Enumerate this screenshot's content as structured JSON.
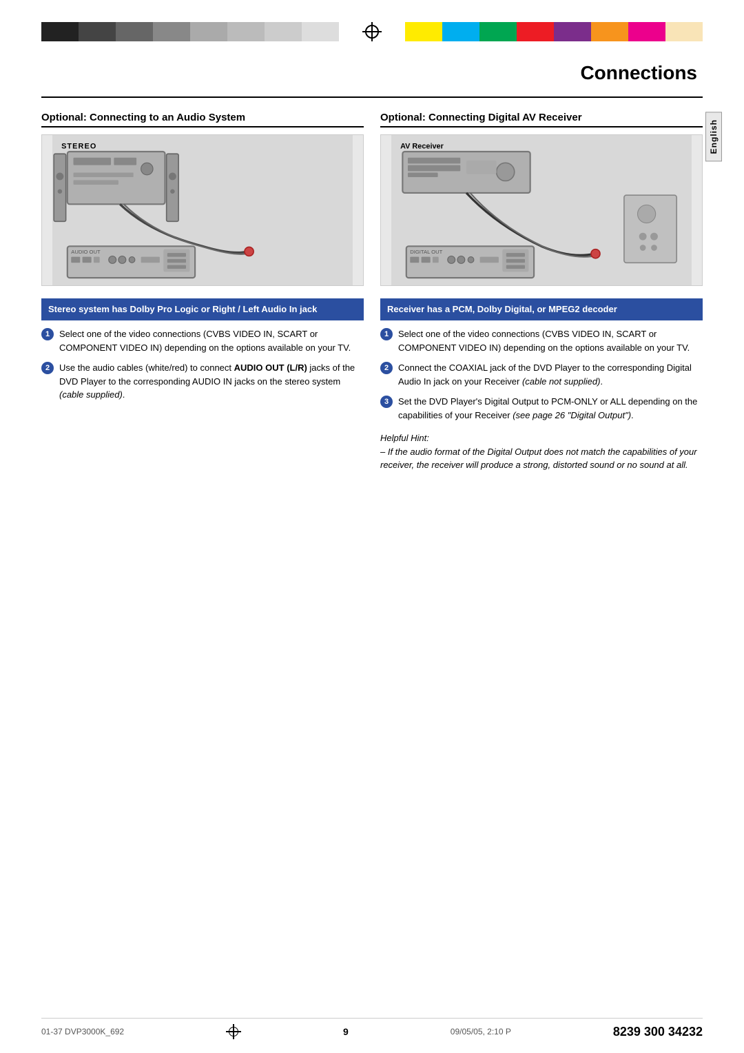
{
  "page": {
    "title": "Connections",
    "page_number": "9",
    "footer_left": "01-37 DVP3000K_692",
    "footer_center": "9",
    "footer_date": "09/05/05, 2:10 P",
    "footer_right": "8239 300 34232",
    "language_tab": "English"
  },
  "color_bars": {
    "left": [
      "#111",
      "#333",
      "#555",
      "#777",
      "#999",
      "#bbb",
      "#ddd",
      "#eee"
    ],
    "right": [
      "#ffeb00",
      "#00aeef",
      "#00a651",
      "#ed1c24",
      "#7b2d8b",
      "#f7941d",
      "#ec008c",
      "#f9e4b7"
    ]
  },
  "left_section": {
    "header": "Optional: Connecting to an Audio System",
    "instruction_header": "Stereo system has Dolby Pro Logic or Right / Left Audio In jack",
    "steps": [
      {
        "num": "1",
        "text": "Select one of the video connections (CVBS VIDEO IN, SCART or COMPONENT VIDEO IN) depending on the options available on your TV."
      },
      {
        "num": "2",
        "text_prefix": "Use the audio cables (white/red) to connect ",
        "bold_text": "AUDIO OUT (L/R)",
        "text_suffix": " jacks of the DVD Player to the corresponding AUDIO IN jacks on the stereo system (cable supplied)."
      }
    ]
  },
  "right_section": {
    "header": "Optional: Connecting Digital AV Receiver",
    "instruction_header": "Receiver has a PCM, Dolby Digital, or MPEG2 decoder",
    "steps": [
      {
        "num": "1",
        "text": "Select one of the video connections (CVBS VIDEO IN, SCART or COMPONENT VIDEO IN) depending on the options available on your TV."
      },
      {
        "num": "2",
        "text": "Connect the COAXIAL jack of the DVD Player to the corresponding Digital Audio In jack on your Receiver (cable not supplied)."
      },
      {
        "num": "3",
        "text": "Set the DVD Player's Digital Output to PCM-ONLY or ALL depending on the capabilities of your Receiver (see page 26 \"Digital Output\")."
      }
    ],
    "helpful_hint_title": "Helpful Hint:",
    "helpful_hint_text": "– If the audio format of the Digital Output does not match the capabilities of your receiver, the receiver will produce a strong, distorted sound or no sound at all."
  },
  "diagram_left": {
    "stereo_label": "STEREO",
    "av_label": ""
  },
  "diagram_right": {
    "av_label": "AV Receiver"
  }
}
